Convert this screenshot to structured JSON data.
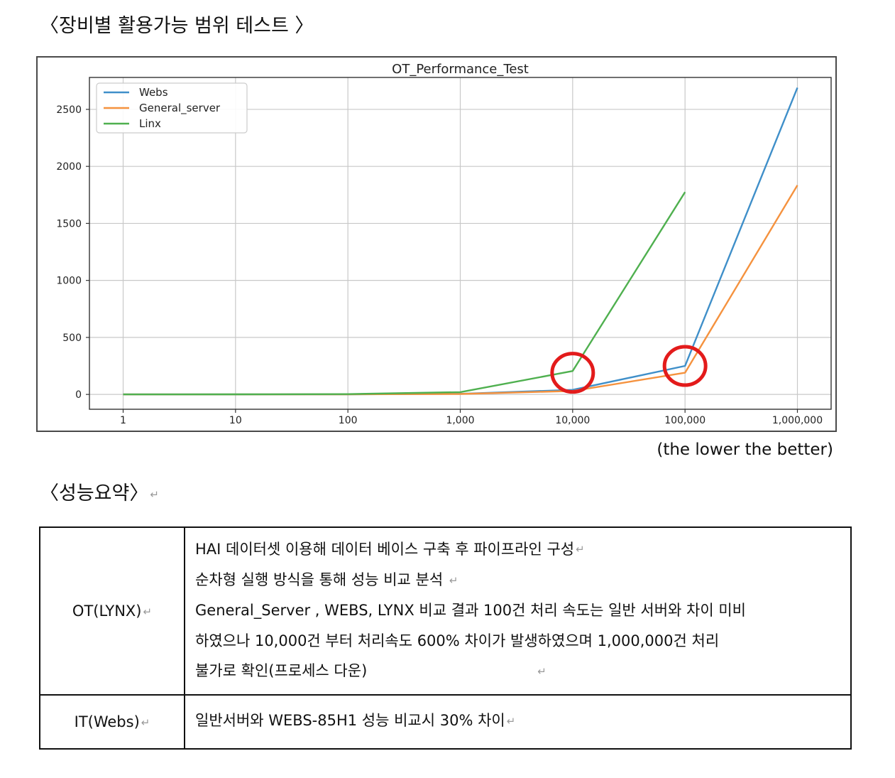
{
  "heading": "〈장비별 활용가능 범위 테스트 〉",
  "chart_data": {
    "type": "line",
    "title": "OT_Performance_Test",
    "xlabel": "",
    "ylabel": "",
    "x_scale": "log",
    "categories": [
      "1",
      "10",
      "100",
      "1,000",
      "10,000",
      "100,000",
      "1,000,000"
    ],
    "x": [
      1,
      10,
      100,
      1000,
      10000,
      100000,
      1000000
    ],
    "yticks": [
      "0",
      "500",
      "1000",
      "1500",
      "2000",
      "2500"
    ],
    "ylim": [
      -130,
      2780
    ],
    "grid": true,
    "legend_position": "top-left",
    "series": [
      {
        "name": "Webs",
        "color": "#3f8fc9",
        "x": [
          1,
          10,
          100,
          1000,
          10000,
          100000,
          1000000
        ],
        "values": [
          0,
          0,
          1,
          5,
          40,
          250,
          2690
        ]
      },
      {
        "name": "General_server",
        "color": "#f5923e",
        "x": [
          1,
          10,
          100,
          1000,
          10000,
          100000,
          1000000
        ],
        "values": [
          0,
          0,
          1,
          4,
          30,
          190,
          1835
        ]
      },
      {
        "name": "Linx",
        "color": "#4fb04f",
        "x": [
          1,
          10,
          100,
          1000,
          10000,
          100000
        ],
        "values": [
          0,
          1,
          3,
          20,
          205,
          1775
        ]
      }
    ],
    "highlights": [
      {
        "x": 10000,
        "y": 190,
        "color": "#e31b1b"
      },
      {
        "x": 100000,
        "y": 250,
        "color": "#e31b1b"
      }
    ]
  },
  "note": "(the lower the better)",
  "summary_heading": "〈성능요약〉",
  "return_mark": "↵",
  "table": {
    "rows": [
      {
        "label": "OT(LYNX)",
        "lines": [
          "HAI 데이터셋 이용해 데이터 베이스 구축 후 파이프라인 구성",
          "순차형 실행 방식을 통해 성능 비교 분석",
          "General_Server , WEBS, LYNX 비교 결과 100건 처리 속도는 일반 서버와 차이 미비",
          "하였으나 10,000건 부터 처리속도 600% 차이가 발생하였으며 1,000,000건 처리",
          "불가로 확인(프로세스 다운)"
        ]
      },
      {
        "label": "IT(Webs)",
        "lines": [
          "일반서버와 WEBS-85H1 성능 비교시 30% 차이"
        ]
      }
    ]
  }
}
